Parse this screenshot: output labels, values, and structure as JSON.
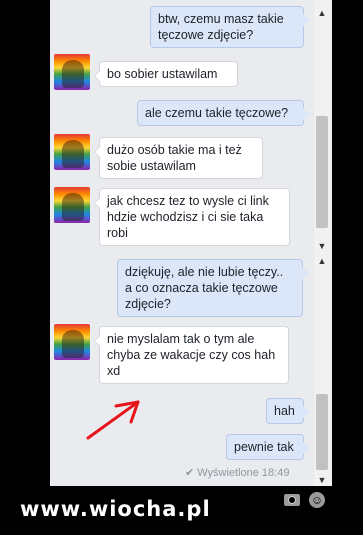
{
  "messages": [
    {
      "dir": "out",
      "text": "btw, czemu masz takie\ntęczowe zdjęcie?"
    },
    {
      "dir": "in",
      "text": "bo sobier ustawilam"
    },
    {
      "dir": "out",
      "text": "ale czemu takie tęczowe?"
    },
    {
      "dir": "in",
      "text": "dużo osób takie ma i też\nsobie ustawilam"
    },
    {
      "dir": "in",
      "text": "jak chcesz tez to wysle ci link\nhdzie wchodzisz i ci sie taka\nrobi"
    },
    {
      "dir": "out",
      "text": "dziękuję, ale nie lubie tęczy..\na co oznacza takie tęczowe\nzdjęcie?"
    },
    {
      "dir": "in",
      "text": "nie myslalam tak o tym ale\nchyba ze wakacje czy cos hah\nxd"
    },
    {
      "dir": "out",
      "text": "hah"
    },
    {
      "dir": "out",
      "text": "pewnie tak"
    }
  ],
  "status": {
    "seen": "Wyświetlone 18:49"
  },
  "icons": {
    "seen": "check-icon",
    "camera": "camera-icon",
    "emoji": "smiley-icon",
    "arrow": "red-arrow-icon"
  },
  "colors": {
    "outgoing": "#dbe6f8",
    "incoming": "#ffffff",
    "arrow": "#e8141c"
  },
  "watermark": "www.wiocha.pl"
}
